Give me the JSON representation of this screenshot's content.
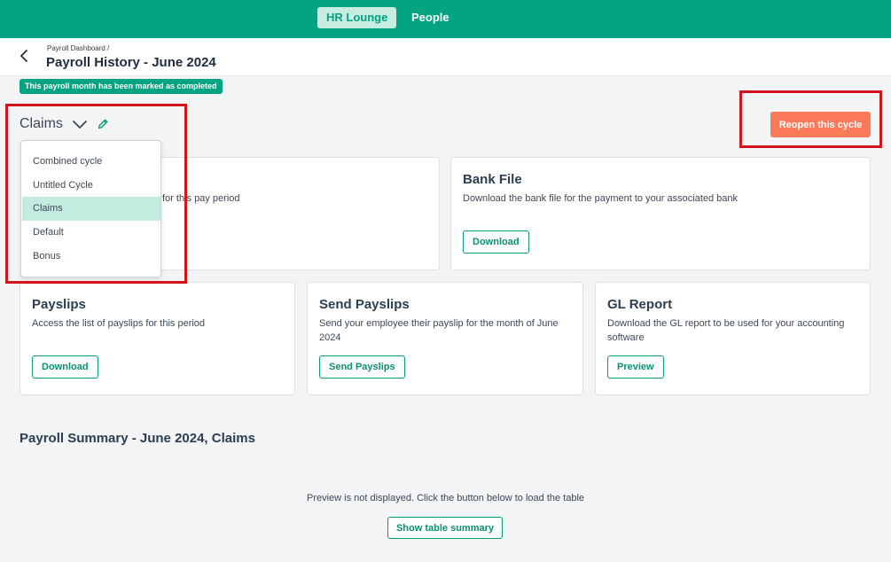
{
  "topnav": {
    "tabs": [
      {
        "label": "HR Lounge",
        "active": true
      },
      {
        "label": "People",
        "active": false
      }
    ]
  },
  "header": {
    "breadcrumb": "Payroll Dashboard /",
    "title": "Payroll History - June 2024"
  },
  "status_badge": "This payroll month has been marked as completed",
  "cycle": {
    "selected": "Claims",
    "options": [
      "Combined cycle",
      "Untitled Cycle",
      "Claims",
      "Default",
      "Bonus"
    ]
  },
  "reopen_label": "Reopen this cycle",
  "cards": {
    "hidden_card": {
      "desc_fragment": "for this pay period"
    },
    "bank_file": {
      "title": "Bank File",
      "desc": "Download the bank file for the payment to your associated bank",
      "button": "Download"
    },
    "payslips": {
      "title": "Payslips",
      "desc": "Access the list of payslips for this period",
      "button": "Download"
    },
    "send_payslips": {
      "title": "Send Payslips",
      "desc": "Send your employee their payslip for the month of June 2024",
      "button": "Send Payslips"
    },
    "gl_report": {
      "title": "GL Report",
      "desc": "Download the GL report to be used for your accounting software",
      "button": "Preview"
    }
  },
  "summary": {
    "title": "Payroll Summary - June 2024, Claims",
    "note": "Preview is not displayed. Click the button below to load the table",
    "button": "Show table summary"
  },
  "colors": {
    "brand_green": "#04a382",
    "reopen_orange": "#fa7a5a",
    "highlight_red": "#d4141d",
    "selected_option_bg": "#c3ebe0"
  },
  "icons": [
    "back-arrow-icon",
    "chevron-down-icon",
    "pencil-edit-icon"
  ]
}
